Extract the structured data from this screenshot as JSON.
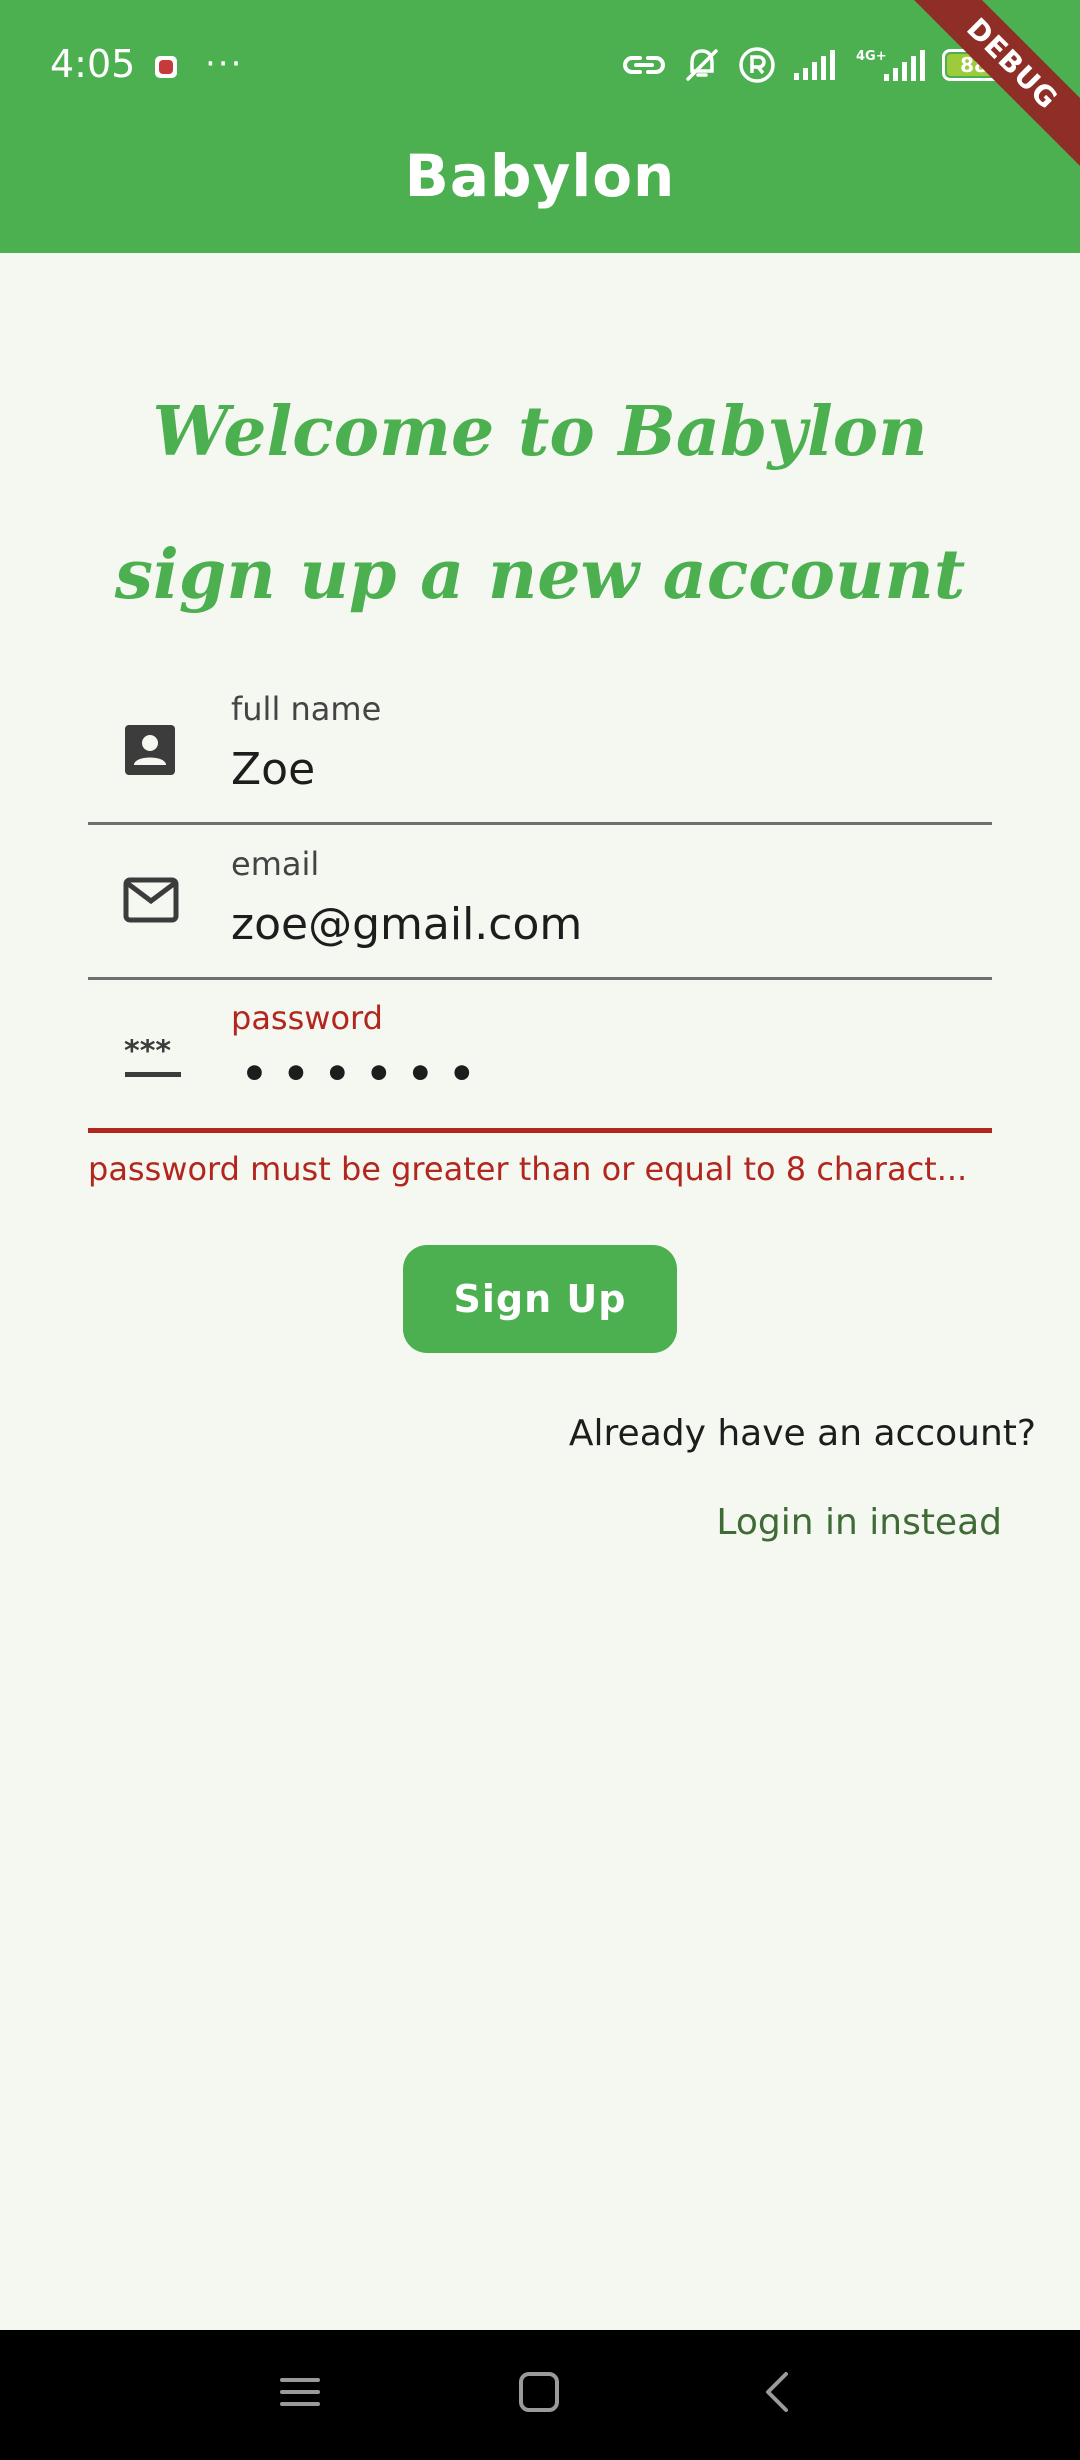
{
  "status_bar": {
    "time": "4:05",
    "overflow_dots": "···",
    "network_label": "4G+",
    "battery_level": "88",
    "icons": [
      "screen-record-icon",
      "link-icon",
      "bell-off-icon",
      "registered-icon",
      "signal-icon",
      "4g-signal-icon",
      "battery-icon"
    ]
  },
  "debug_banner": "DEBUG",
  "appbar": {
    "title": "Babylon"
  },
  "heading": {
    "welcome": "Welcome to Babylon",
    "subtitle": "sign up a new account"
  },
  "form": {
    "full_name": {
      "label": "full name",
      "value": "Zoe",
      "icon": "contact-card-icon"
    },
    "email": {
      "label": "email",
      "value": "zoe@gmail.com",
      "icon": "mail-icon"
    },
    "password": {
      "label": "password",
      "value": "•  •  •  •  •  •",
      "icon": "password-icon"
    },
    "error": "password must be greater than or equal to 8 charact..."
  },
  "signup_button": "Sign Up",
  "already_text": "Already have an account?",
  "login_link": "Login in instead",
  "colors": {
    "primary": "#4caf50",
    "background": "#f5f8f1",
    "error": "#b3261e",
    "debug": "#8e2e26"
  },
  "nav_bar": {
    "icons": [
      "menu-icon",
      "home-icon",
      "back-icon"
    ]
  }
}
